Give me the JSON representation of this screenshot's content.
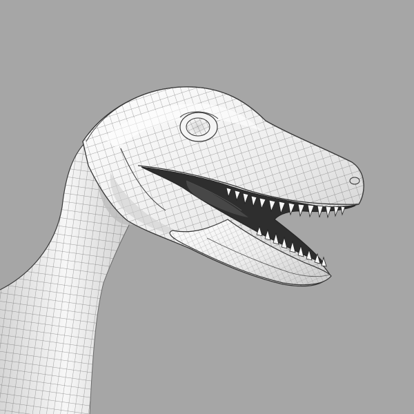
{
  "scene": {
    "subject_icon": "dinosaur-wireframe-icon",
    "colors": {
      "background": "#a6a6a6",
      "surface_light": "#fbfbfb",
      "surface_mid": "#e2e2e2",
      "surface_shadow": "#c4c4c4",
      "wire": "#4a4a4a",
      "mouth_interior": "#2a2a2a",
      "teeth": "#f4f4f4"
    }
  }
}
